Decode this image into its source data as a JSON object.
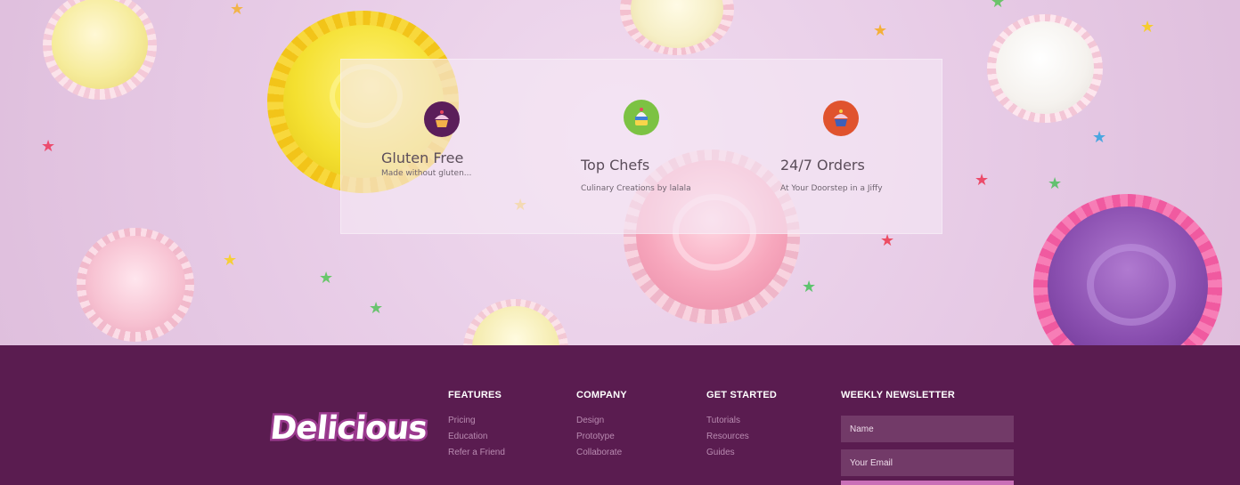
{
  "hero": {
    "features": [
      {
        "icon": "cupcake-icon",
        "badge_color": "#5b1e5a",
        "title": "Gluten Free",
        "description": "Made without gluten..."
      },
      {
        "icon": "cake-icon",
        "badge_color": "#7cc243",
        "title": "Top Chefs",
        "description": "Culinary Creations by lalala"
      },
      {
        "icon": "cupcake-icon",
        "badge_color": "#e0532e",
        "title": "24/7 Orders",
        "description": "At Your Doorstep in a Jiffy"
      }
    ]
  },
  "footer": {
    "logo_text": "Delicious",
    "columns": [
      {
        "heading": "FEATURES",
        "links": [
          "Pricing",
          "Education",
          "Refer a Friend"
        ]
      },
      {
        "heading": "COMPANY",
        "links": [
          "Design",
          "Prototype",
          "Collaborate"
        ]
      },
      {
        "heading": "GET STARTED",
        "links": [
          "Tutorials",
          "Resources",
          "Guides"
        ]
      }
    ],
    "newsletter": {
      "heading": "WEEKLY NEWSLETTER",
      "name_placeholder": "Name",
      "email_placeholder": "Your Email"
    }
  },
  "colors": {
    "footer_bg": "#5a1c50",
    "hero_bg": "#e9cde7",
    "accent": "#c96fb7"
  }
}
